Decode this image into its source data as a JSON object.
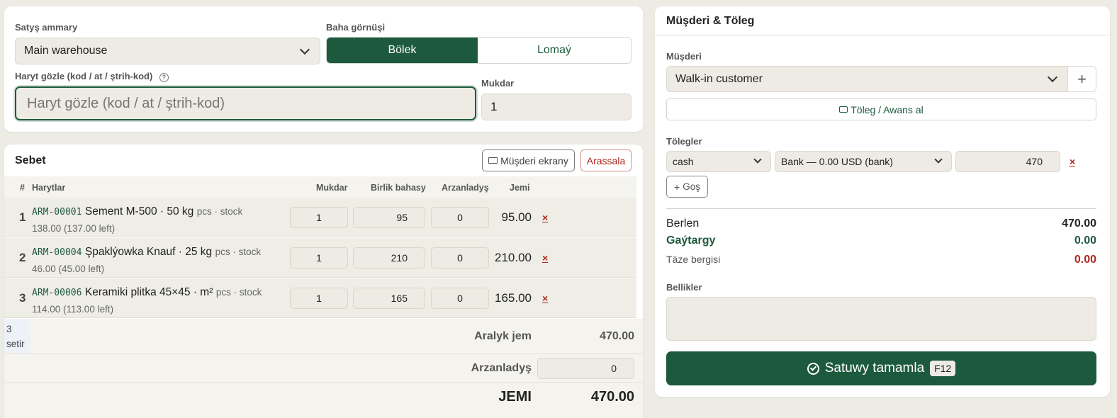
{
  "top_panel": {
    "warehouse_label": "Satyş ammary",
    "warehouse_value": "Main warehouse",
    "price_type_label": "Baha görnüşi",
    "price_types": [
      "Bölek",
      "Lomaý"
    ],
    "active_price_type": "Bölek",
    "search_label": "Haryt gözle (kod / at / ştrih-kod)",
    "search_placeholder": "Haryt gözle (kod / at / ştrih-kod)",
    "qty_label": "Mukdar",
    "qty_value": "1"
  },
  "cart": {
    "title": "Sebet",
    "customer_screen_button": "Müşderi ekrany",
    "clear_button": "Arassala",
    "columns": [
      "#",
      "Harytlar",
      "Mukdar",
      "Birlik bahasy",
      "Arzanladyş",
      "Jemi"
    ],
    "rows": [
      {
        "num": "1",
        "code": "ARM-00001",
        "name": "Sement M-500 · 50 kg",
        "meta": "pcs · stock",
        "stock": "138.00 (137.00 left)",
        "qty": "1",
        "price": "95",
        "discount": "0",
        "total": "95.00",
        "remove": "×"
      },
      {
        "num": "2",
        "code": "ARM-00004",
        "name": "Şpaklýowka Knauf · 25 kg",
        "meta": "pcs · stock",
        "stock": "46.00 (45.00 left)",
        "qty": "1",
        "price": "210",
        "discount": "0",
        "total": "210.00",
        "remove": "×"
      },
      {
        "num": "3",
        "code": "ARM-00006",
        "name": "Keramiki plitka 45×45 · m²",
        "meta": "pcs · stock",
        "stock": "114.00 (113.00 left)",
        "qty": "1",
        "price": "165",
        "discount": "0",
        "total": "165.00",
        "remove": "×"
      }
    ],
    "row_count": "3",
    "row_count_unit": "setir",
    "subtotal_label": "Aralyk jem",
    "subtotal_value": "470.00",
    "discount_label": "Arzanladyş",
    "discount_value": "0",
    "grand_label": "JEMI",
    "grand_value": "470.00"
  },
  "customer_panel": {
    "title": "Müşderi & Töleg",
    "customer_label": "Müşderi",
    "customer_value": "Walk-in customer",
    "add_symbol": "+",
    "advance_button": "Töleg / Awans al",
    "payments_label": "Tölegler",
    "payment": {
      "method": "cash",
      "account": "Bank — 0.00 USD (bank)",
      "amount": "470",
      "remove": "×"
    },
    "add_payment_button": "Goş",
    "given_label": "Berlen",
    "given_value": "470.00",
    "change_label": "Gaýtargy",
    "change_value": "0.00",
    "new_debt_label": "Täze bergisi",
    "new_debt_value": "0.00",
    "notes_label": "Bellikler",
    "notes_value": "",
    "complete_button": "Satuwy tamamla",
    "complete_shortcut": "F12"
  },
  "colors": {
    "accent": "#1d5a3d",
    "danger": "#b3261e",
    "bg": "#ecebe4",
    "field": "#edebe3"
  }
}
